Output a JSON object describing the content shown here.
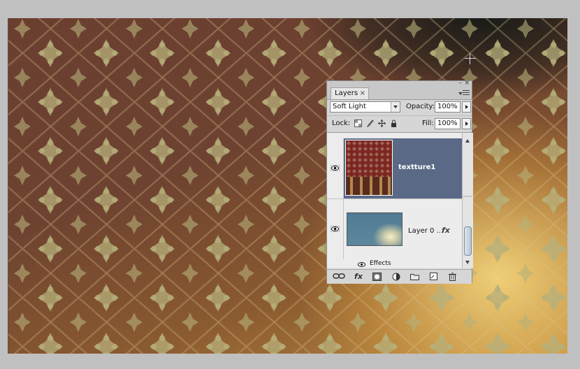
{
  "canvas": {
    "image": "damask-wallpaper-texture",
    "cursor_icon": "crosshair-icon"
  },
  "panel": {
    "tab_label": "Layers",
    "blend_mode": "Soft Light",
    "opacity_label": "Opacity:",
    "opacity_value": "100%",
    "lock_label": "Lock:",
    "fill_label": "Fill:",
    "fill_value": "100%",
    "layers": [
      {
        "name": "textture1",
        "selected": true,
        "visible": true
      },
      {
        "name": "Layer 0 ...",
        "selected": false,
        "visible": true,
        "has_effects": true
      }
    ],
    "fx_mark": "fx",
    "effects_label": "Effects",
    "bottom_fx_label": "fx"
  },
  "colors": {
    "selected_layer": "#5a6a86",
    "panel_bg": "#d6d6d6",
    "canvas_highlight": "#e8c872"
  }
}
